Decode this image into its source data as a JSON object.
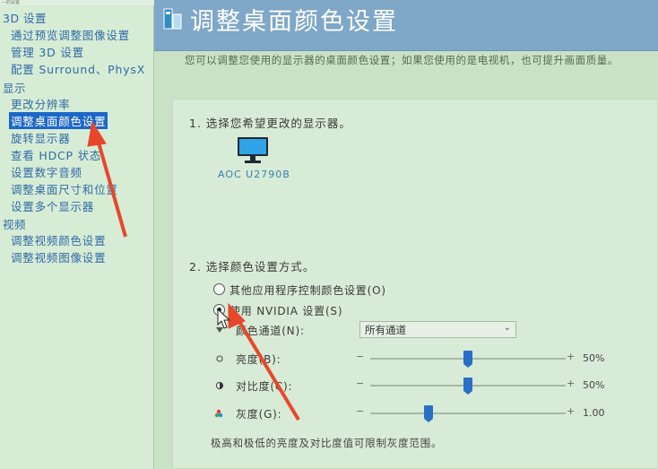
{
  "window_title_fragment": "—的设置",
  "sidebar": {
    "categories": [
      {
        "label": "3D 设置",
        "items": [
          "通过预览调整图像设置",
          "管理 3D 设置",
          "配置 Surround、PhysX"
        ]
      },
      {
        "label": "显示",
        "items": [
          "更改分辨率",
          "调整桌面颜色设置",
          "旋转显示器",
          "查看 HDCP 状态",
          "设置数字音频",
          "调整桌面尺寸和位置",
          "设置多个显示器"
        ]
      },
      {
        "label": "视频",
        "items": [
          "调整视频颜色设置",
          "调整视频图像设置"
        ]
      }
    ],
    "selected": "调整桌面颜色设置"
  },
  "header": {
    "title": "调整桌面颜色设置",
    "description": "您可以调整您使用的显示器的桌面颜色设置；如果您使用的是电视机，也可提升画面质量。"
  },
  "step1": {
    "label": "1. 选择您希望更改的显示器。",
    "monitor_name": "AOC U2790B"
  },
  "step2": {
    "label": "2. 选择颜色设置方式。",
    "option_other": "其他应用程序控制颜色设置(O)",
    "option_nvidia": "使用 NVIDIA 设置(S)",
    "selected_option": "nvidia"
  },
  "settings": {
    "channel": {
      "label": "颜色通道(N):",
      "value": "所有通道"
    },
    "brightness": {
      "label": "亮度(B):",
      "minus": "−",
      "plus": "+",
      "value_text": "50%",
      "level": 0.5
    },
    "contrast": {
      "label": "对比度(C):",
      "minus": "−",
      "plus": "+",
      "value_text": "50%",
      "level": 0.5
    },
    "gamma": {
      "label": "灰度(G):",
      "minus": "−",
      "plus": "+",
      "value_text": "1.00",
      "level": 0.3
    },
    "note": "极高和极低的亮度及对比度值可限制灰度范围。"
  },
  "colors": {
    "selected_bg": "#1d67c9",
    "header_bg": "#7fa7c8",
    "annotation_arrow": "#e8472c",
    "slider_thumb": "#2a6fc6"
  }
}
